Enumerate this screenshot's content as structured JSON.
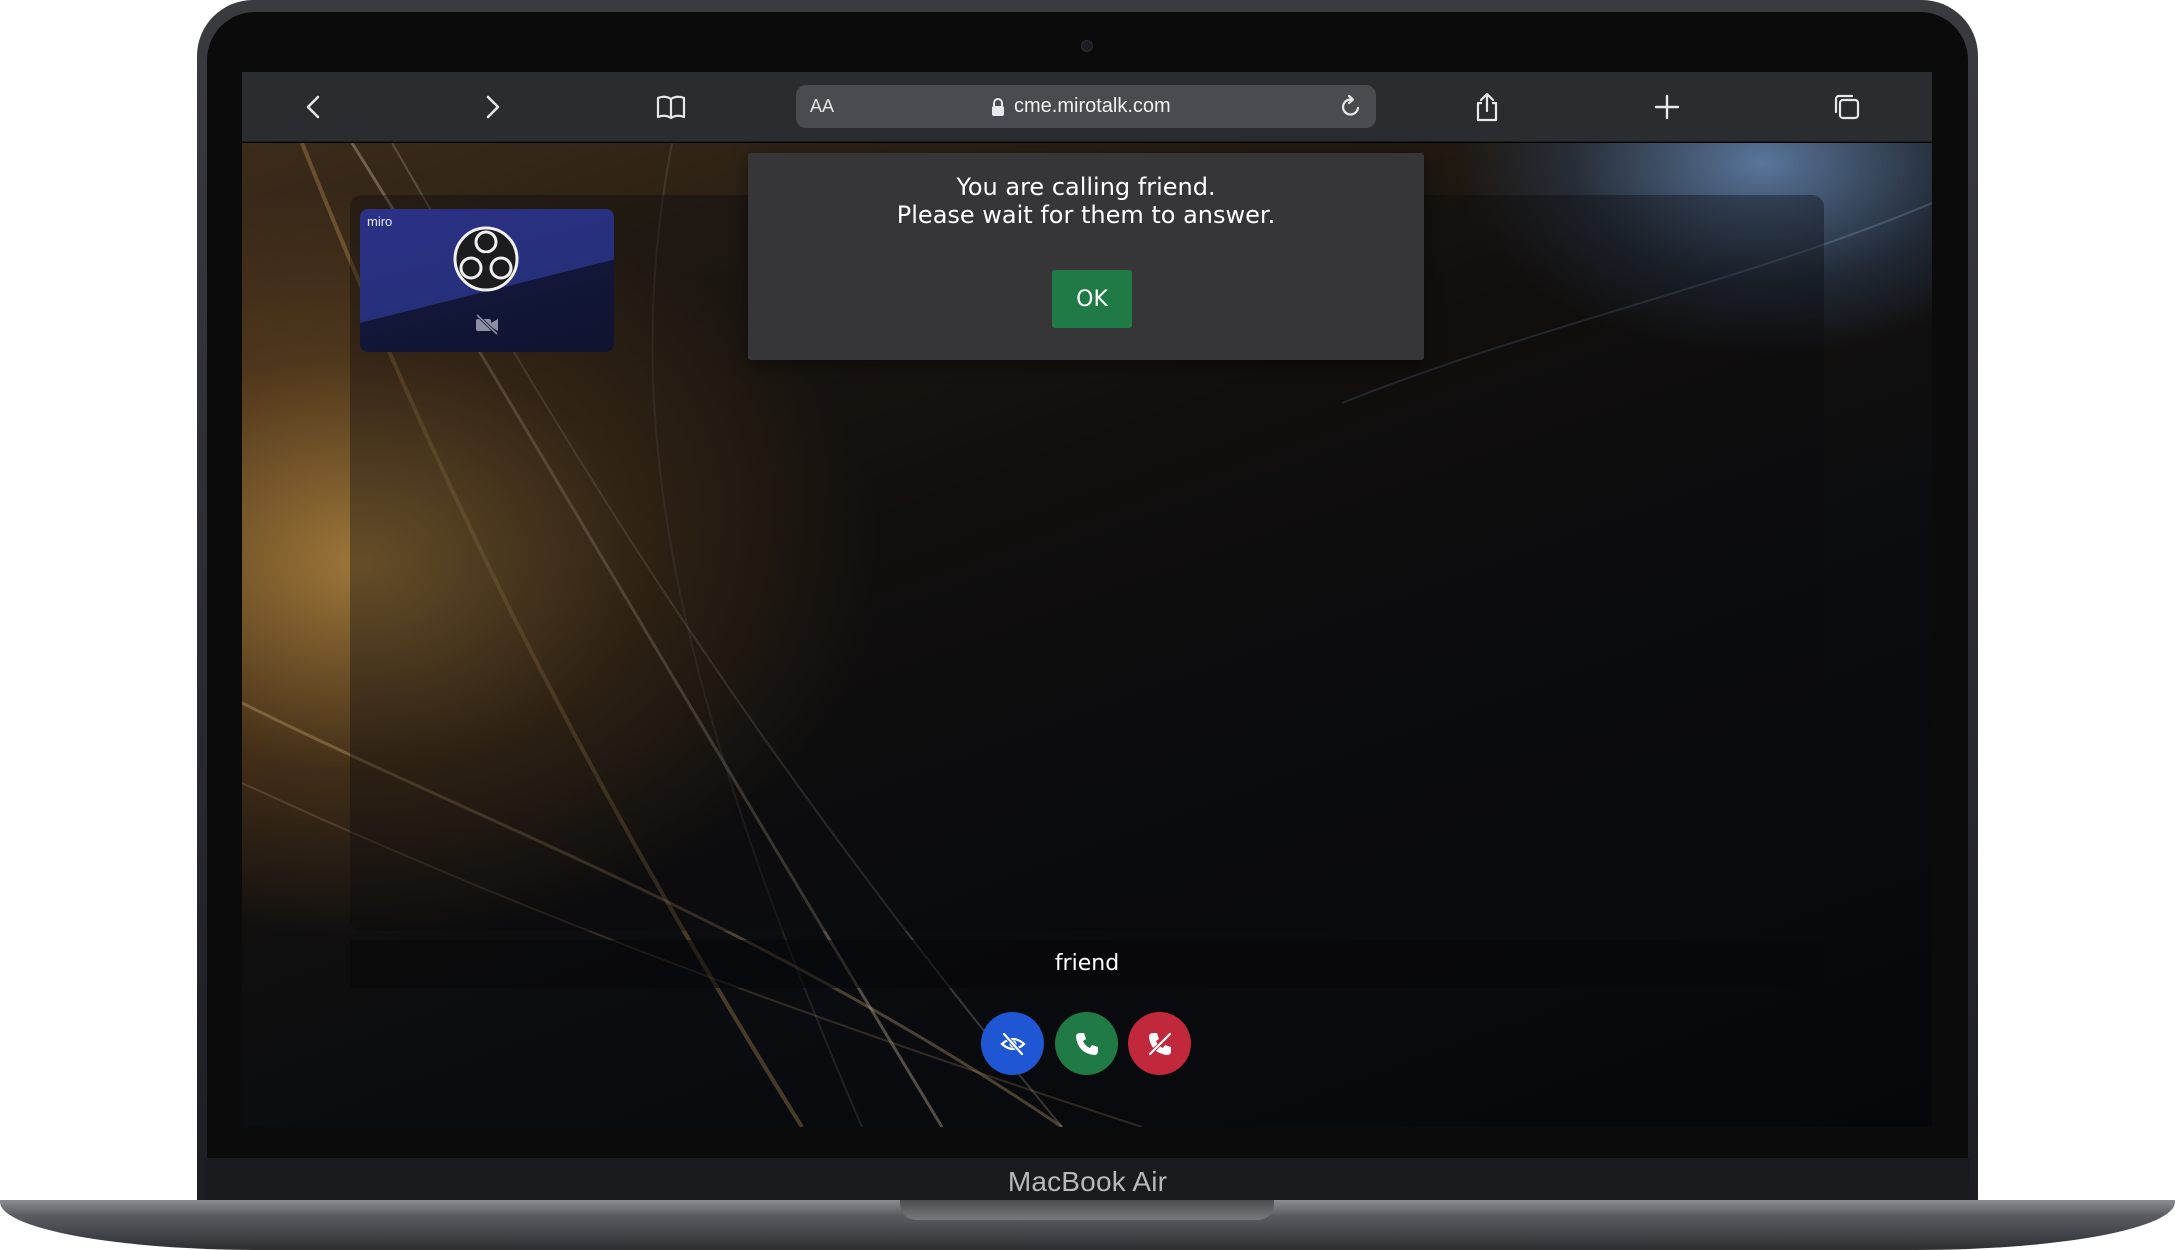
{
  "browser": {
    "text_size_label": "AA",
    "url": "cme.mirotalk.com",
    "icons": [
      "back-icon",
      "forward-icon",
      "bookmarks-icon",
      "lock-icon",
      "reload-icon",
      "share-icon",
      "new-tab-icon",
      "tabs-icon"
    ]
  },
  "app": {
    "local_tile": {
      "name": "miro",
      "avatar_icon": "obs-logo-icon",
      "status_icon": "camera-off-icon"
    },
    "dialog": {
      "message_line1": "You are calling friend.",
      "message_line2": "Please wait for them to answer.",
      "ok_label": "OK"
    },
    "remote_name": "friend",
    "call_buttons": [
      {
        "icon": "eye-off-icon",
        "color": "#1f56d3"
      },
      {
        "icon": "phone-icon",
        "color": "#1f7a46"
      },
      {
        "icon": "phone-hangup-icon",
        "color": "#c1283b"
      }
    ]
  },
  "device": {
    "label": "MacBook Air"
  }
}
